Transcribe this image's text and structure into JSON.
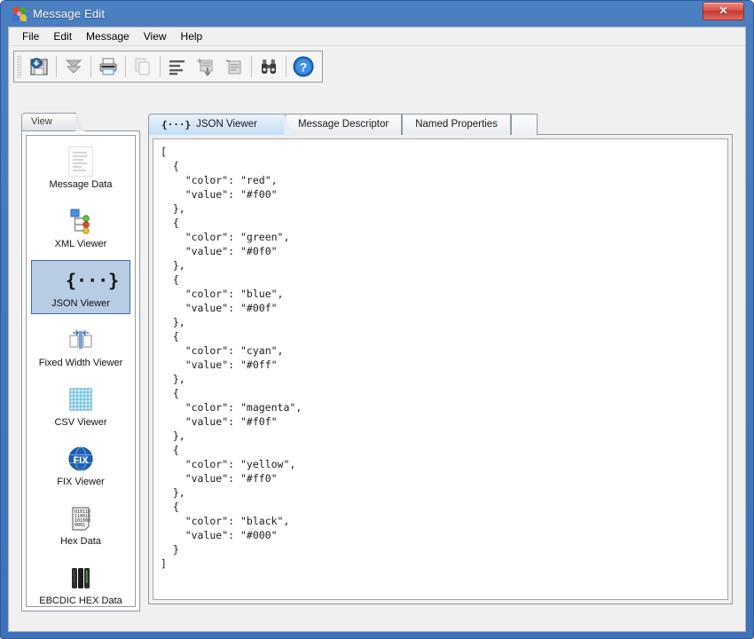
{
  "window": {
    "title": "Message Edit",
    "app_icon": "pinwheel-icon",
    "close_label": "✕",
    "accent_color": "#3f72b8",
    "selection_color": "#b8cce4",
    "selection_border_color": "#3a6ea5"
  },
  "menubar": {
    "items": [
      {
        "label": "File"
      },
      {
        "label": "Edit"
      },
      {
        "label": "Message"
      },
      {
        "label": "View"
      },
      {
        "label": "Help"
      }
    ]
  },
  "toolbar": {
    "buttons": [
      {
        "name": "save-icon",
        "title": "Save"
      },
      {
        "name": "collapse-all-icon",
        "title": "Collapse All"
      },
      {
        "name": "print-icon",
        "title": "Print"
      },
      {
        "name": "copy-icon",
        "title": "Copy"
      },
      {
        "name": "format-lines-icon",
        "title": "Format"
      },
      {
        "name": "add-item-icon",
        "title": "Add"
      },
      {
        "name": "remove-item-icon",
        "title": "Remove"
      },
      {
        "name": "find-icon",
        "title": "Find"
      },
      {
        "name": "help-icon",
        "title": "Help"
      }
    ]
  },
  "sidebar": {
    "tab_label": "View",
    "selected_index": 2,
    "items": [
      {
        "label": "Message Data",
        "icon": "document-icon"
      },
      {
        "label": "XML Viewer",
        "icon": "xml-tree-icon"
      },
      {
        "label": "JSON Viewer",
        "icon": "json-braces-icon",
        "glyph": "{···}"
      },
      {
        "label": "Fixed Width Viewer",
        "icon": "fixed-width-icon"
      },
      {
        "label": "CSV Viewer",
        "icon": "csv-grid-icon"
      },
      {
        "label": "FIX Viewer",
        "icon": "fix-globe-icon",
        "glyph": "FIX"
      },
      {
        "label": "Hex Data",
        "icon": "hex-data-icon"
      },
      {
        "label": "EBCDIC HEX Data",
        "icon": "ebcdic-hex-icon"
      }
    ]
  },
  "content": {
    "tabs": [
      {
        "label": "JSON Viewer",
        "icon": "json-braces-icon",
        "glyph": "{···}",
        "active": true
      },
      {
        "label": "Message Descriptor",
        "active": false
      },
      {
        "label": "Named Properties",
        "active": false
      }
    ],
    "json_text": "[\n  {\n    \"color\": \"red\",\n    \"value\": \"#f00\"\n  },\n  {\n    \"color\": \"green\",\n    \"value\": \"#0f0\"\n  },\n  {\n    \"color\": \"blue\",\n    \"value\": \"#00f\"\n  },\n  {\n    \"color\": \"cyan\",\n    \"value\": \"#0ff\"\n  },\n  {\n    \"color\": \"magenta\",\n    \"value\": \"#f0f\"\n  },\n  {\n    \"color\": \"yellow\",\n    \"value\": \"#ff0\"\n  },\n  {\n    \"color\": \"black\",\n    \"value\": \"#000\"\n  }\n]",
    "json_records": [
      {
        "color": "red",
        "value": "#f00"
      },
      {
        "color": "green",
        "value": "#0f0"
      },
      {
        "color": "blue",
        "value": "#00f"
      },
      {
        "color": "cyan",
        "value": "#0ff"
      },
      {
        "color": "magenta",
        "value": "#f0f"
      },
      {
        "color": "yellow",
        "value": "#ff0"
      },
      {
        "color": "black",
        "value": "#000"
      }
    ]
  }
}
